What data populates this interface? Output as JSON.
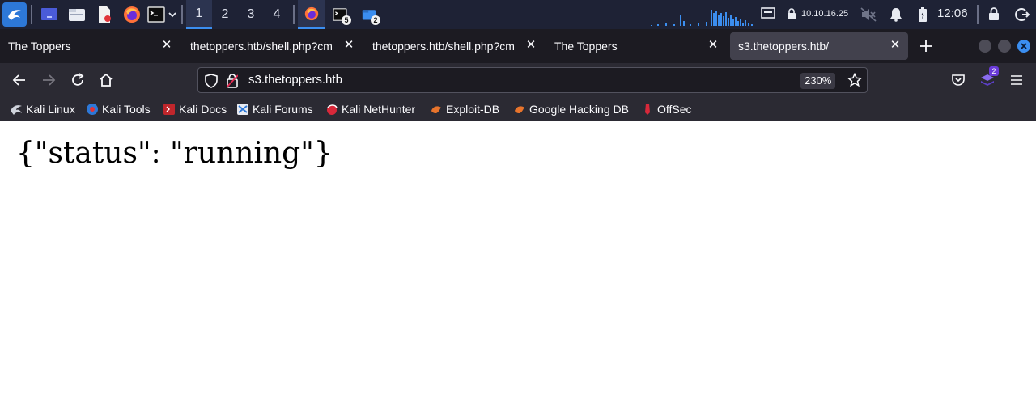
{
  "taskbar": {
    "workspaces": [
      "1",
      "2",
      "3",
      "4"
    ],
    "active_workspace": "1",
    "terminal_badge": "5",
    "files_badge": "2",
    "ip": "10.10.16.25",
    "clock": "12:06"
  },
  "tabs": [
    {
      "title": "The Toppers",
      "selected": false
    },
    {
      "title": "thetoppers.htb/shell.php?cm",
      "selected": false
    },
    {
      "title": "thetoppers.htb/shell.php?cm",
      "selected": false
    },
    {
      "title": "The Toppers",
      "selected": false
    },
    {
      "title": "s3.thetoppers.htb/",
      "selected": true
    }
  ],
  "navbar": {
    "url": "s3.thetoppers.htb",
    "zoom": "230%",
    "extension_badge": "2"
  },
  "bookmarks": [
    {
      "label": "Kali Linux",
      "icon": "kali-dragon-icon"
    },
    {
      "label": "Kali Tools",
      "icon": "kali-tools-icon"
    },
    {
      "label": "Kali Docs",
      "icon": "kali-docs-icon"
    },
    {
      "label": "Kali Forums",
      "icon": "kali-forums-icon"
    },
    {
      "label": "Kali NetHunter",
      "icon": "kali-nethunter-icon"
    },
    {
      "label": "Exploit-DB",
      "icon": "exploit-db-icon"
    },
    {
      "label": "Google Hacking DB",
      "icon": "ghdb-icon"
    },
    {
      "label": "OffSec",
      "icon": "offsec-icon"
    }
  ],
  "page": {
    "body_text": "{\"status\": \"running\"}"
  },
  "colors": {
    "taskbar_bg": "#1e2235",
    "accent": "#3b8ef0",
    "browser_chrome": "#2b2a33",
    "tabstrip_bg": "#1c1b22",
    "selected_tab": "#42414d"
  }
}
